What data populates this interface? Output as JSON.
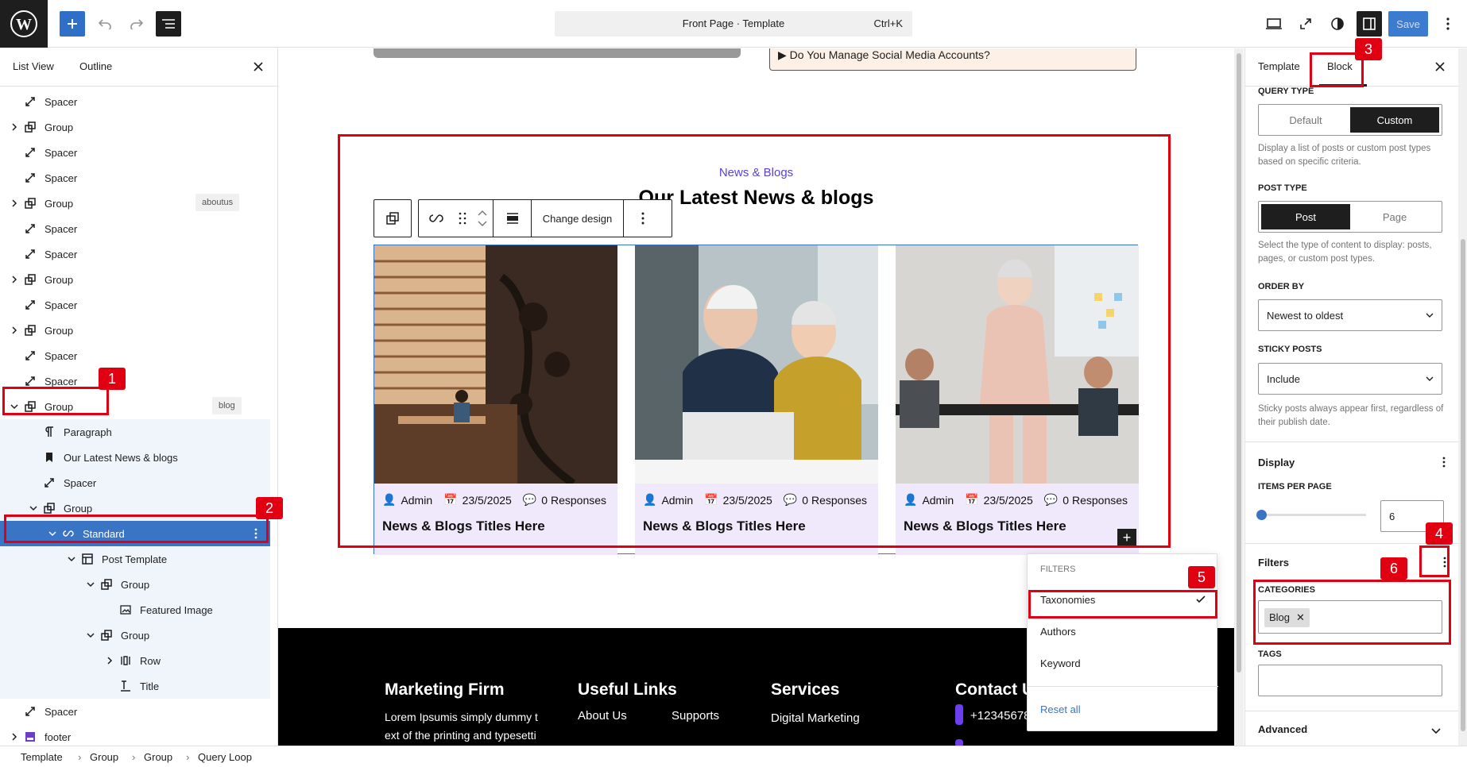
{
  "topbar": {
    "doc_title": "Front Page · Template",
    "doc_shortcut": "Ctrl+K",
    "save_label": "Save"
  },
  "left_panel": {
    "tabs": [
      "List View",
      "Outline"
    ],
    "tree": [
      {
        "label": "Spacer",
        "icon": "spacer-icon"
      },
      {
        "label": "Group",
        "icon": "group-icon",
        "expandable": true
      },
      {
        "label": "Spacer",
        "icon": "spacer-icon"
      },
      {
        "label": "Spacer",
        "icon": "spacer-icon"
      },
      {
        "label": "Group",
        "icon": "group-icon",
        "expandable": true,
        "badge": "aboutus"
      },
      {
        "label": "Spacer",
        "icon": "spacer-icon"
      },
      {
        "label": "Spacer",
        "icon": "spacer-icon"
      },
      {
        "label": "Group",
        "icon": "group-icon",
        "expandable": true
      },
      {
        "label": "Spacer",
        "icon": "spacer-icon"
      },
      {
        "label": "Group",
        "icon": "group-icon",
        "expandable": true
      },
      {
        "label": "Spacer",
        "icon": "spacer-icon"
      },
      {
        "label": "Spacer",
        "icon": "spacer-icon"
      },
      {
        "label": "Group",
        "icon": "group-icon",
        "expanded": true,
        "badge": "blog"
      },
      {
        "label": "Paragraph",
        "icon": "paragraph-icon"
      },
      {
        "label": "Our Latest News & blogs",
        "icon": "heading-bookmark-icon"
      },
      {
        "label": "Spacer",
        "icon": "spacer-icon"
      },
      {
        "label": "Group",
        "icon": "group-icon",
        "expanded": true
      },
      {
        "label": "Standard",
        "icon": "query-loop-icon",
        "expanded": true,
        "selected": true
      },
      {
        "label": "Post Template",
        "icon": "post-template-icon",
        "expanded": true
      },
      {
        "label": "Group",
        "icon": "group-icon",
        "expanded": true
      },
      {
        "label": "Featured Image",
        "icon": "featured-image-icon"
      },
      {
        "label": "Group",
        "icon": "group-icon",
        "expanded": true
      },
      {
        "label": "Row",
        "icon": "row-icon",
        "expandable": true
      },
      {
        "label": "Title",
        "icon": "title-icon"
      },
      {
        "label": "Spacer",
        "icon": "spacer-icon"
      },
      {
        "label": "footer",
        "icon": "footer-icon",
        "expandable": true
      }
    ]
  },
  "canvas": {
    "faq_item": "Do You Manage Social Media Accounts?",
    "section_eyebrow": "News & Blogs",
    "section_title": "Our Latest News & blogs",
    "toolbar": {
      "change_design": "Change design"
    },
    "cards": [
      {
        "author": "Admin",
        "date": "23/5/2025",
        "responses": "0 Responses",
        "title": "News & Blogs Titles Here"
      },
      {
        "author": "Admin",
        "date": "23/5/2025",
        "responses": "0 Responses",
        "title": "News & Blogs Titles Here"
      },
      {
        "author": "Admin",
        "date": "23/5/2025",
        "responses": "0 Responses",
        "title": "News & Blogs Titles Here"
      }
    ],
    "footer": {
      "col1_title": "Marketing Firm",
      "col1_text_line1": "Lorem Ipsumis simply dummy t",
      "col1_text_line2": "ext of the printing and typesetti",
      "col2_title": "Useful Links",
      "col2_link1": "About Us",
      "col2_link2": "Supports",
      "col3_title": "Services",
      "col3_link1": "Digital Marketing",
      "col4_title": "Contact U",
      "col4_phone": "+12345678"
    }
  },
  "filters_menu": {
    "heading": "FILTERS",
    "items": [
      "Taxonomies",
      "Authors",
      "Keyword"
    ],
    "checked": "Taxonomies",
    "reset": "Reset all"
  },
  "right_panel": {
    "tabs": [
      "Template",
      "Block"
    ],
    "query_type_label": "QUERY TYPE",
    "query_type_options": [
      "Default",
      "Custom"
    ],
    "query_type_selected": "Custom",
    "query_type_help": "Display a list of posts or custom post types based on specific criteria.",
    "post_type_label": "POST TYPE",
    "post_type_options": [
      "Post",
      "Page"
    ],
    "post_type_selected": "Post",
    "post_type_help": "Select the type of content to display: posts, pages, or custom post types.",
    "order_by_label": "ORDER BY",
    "order_by_value": "Newest to oldest",
    "sticky_label": "STICKY POSTS",
    "sticky_value": "Include",
    "sticky_help": "Sticky posts always appear first, regardless of their publish date.",
    "display_title": "Display",
    "items_per_page_label": "ITEMS PER PAGE",
    "items_per_page_value": "6",
    "filters_title": "Filters",
    "categories_label": "CATEGORIES",
    "category_token": "Blog",
    "tags_label": "TAGS",
    "advanced_title": "Advanced"
  },
  "breadcrumb": [
    "Template",
    "Group",
    "Group",
    "Query Loop"
  ],
  "annotations": [
    "1",
    "2",
    "3",
    "4",
    "5",
    "6"
  ],
  "colors": {
    "accent": "#3a74c4",
    "annotation_red": "#e00012",
    "eyebrow_purple": "#5b3fd9",
    "card_bg": "#efe9fb"
  }
}
